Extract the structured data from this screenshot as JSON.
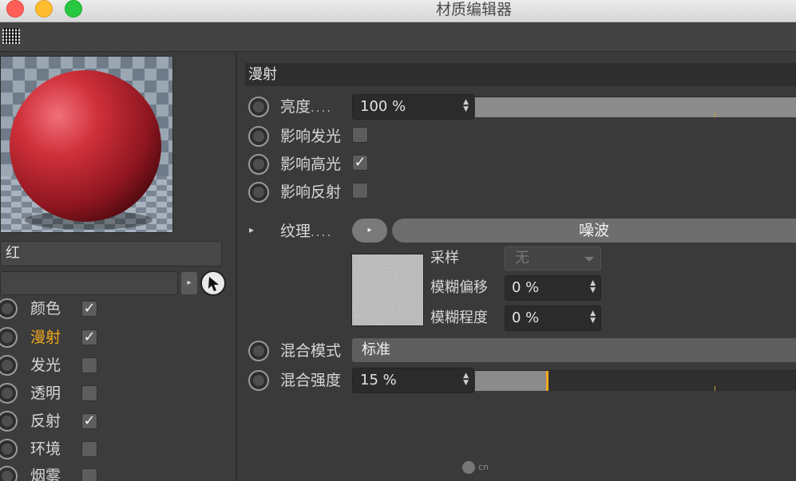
{
  "window": {
    "title": "材质编辑器"
  },
  "material": {
    "name": "红",
    "path_value": ""
  },
  "channels": [
    {
      "label": "颜色",
      "checked": true,
      "active": false
    },
    {
      "label": "漫射",
      "checked": true,
      "active": true
    },
    {
      "label": "发光",
      "checked": false,
      "active": false
    },
    {
      "label": "透明",
      "checked": false,
      "active": false
    },
    {
      "label": "反射",
      "checked": true,
      "active": false
    },
    {
      "label": "环境",
      "checked": false,
      "active": false
    },
    {
      "label": "烟雾",
      "checked": false,
      "active": false
    }
  ],
  "diffuse": {
    "section_title": "漫射",
    "brightness": {
      "label": "亮度",
      "dots": "....",
      "value": "100 %",
      "level": 1.0
    },
    "affect_glow": {
      "label": "影响发光",
      "checked": false
    },
    "affect_specular": {
      "label": "影响高光",
      "checked": true
    },
    "affect_reflection": {
      "label": "影响反射",
      "checked": false
    },
    "texture": {
      "label": "纹理",
      "dots": "....",
      "shader": "噪波"
    },
    "sampling": {
      "label": "采样",
      "value": "无"
    },
    "blur_offset": {
      "label": "模糊偏移",
      "value": "0 %"
    },
    "blur_scale": {
      "label": "模糊程度",
      "value": "0 %"
    },
    "blend_mode": {
      "label": "混合模式",
      "value": "标准"
    },
    "blend_strength": {
      "label": "混合强度",
      "value": "15 %",
      "level": 0.15
    }
  },
  "watermark": {
    "text": "cn"
  },
  "icons": {
    "check": "✓",
    "play": "▸",
    "spin": "⬍"
  },
  "colors": {
    "accent": "#f0a81c",
    "sphere": "#c8262f"
  }
}
